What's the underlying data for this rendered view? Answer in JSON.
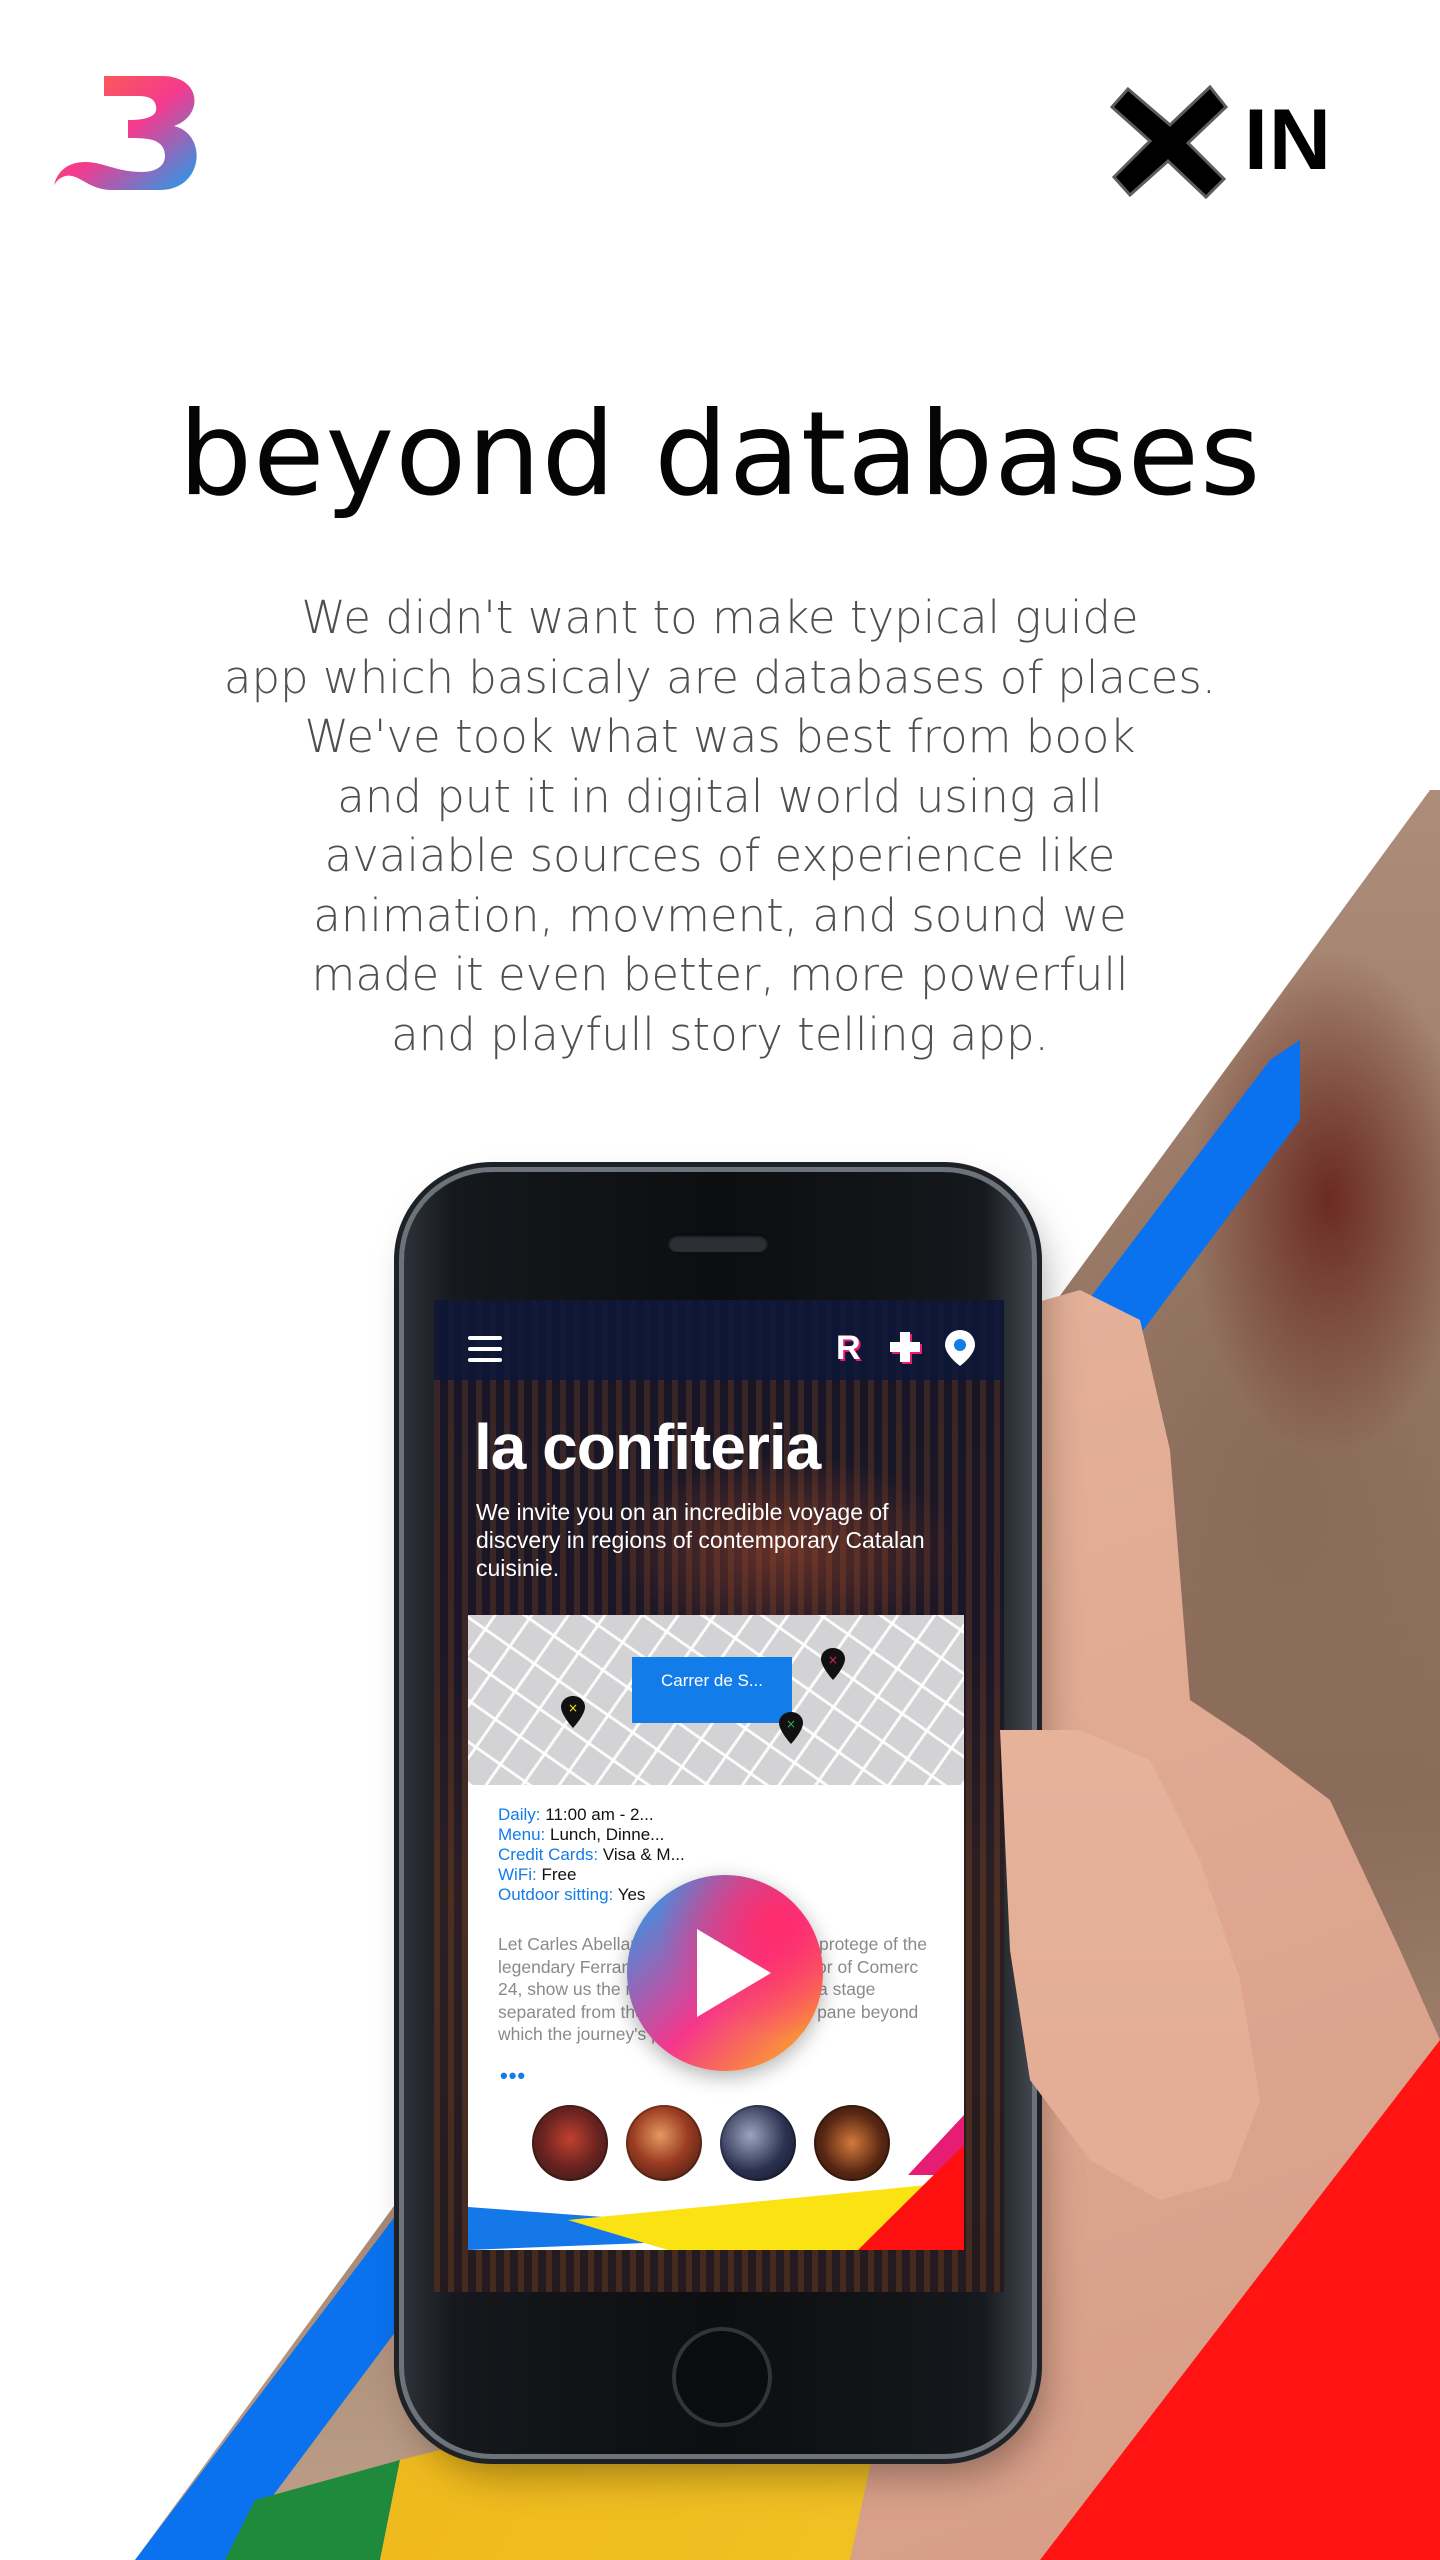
{
  "header": {
    "brand_logo": "b-wave-logo",
    "partner_logo_text": "IN",
    "partner_logo_icon": "x-mark-icon"
  },
  "hero": {
    "headline": "beyond databases",
    "description": "We didn't want to make typical guide\napp which basicaly are databases of places.\nWe've took what was best from book\nand put it in digital world using all\navaiable sources of experience like\nanimation, movment, and sound we\nmade it even better, more powerfull\nand playfull story telling app."
  },
  "app": {
    "toolbar": {
      "menu_icon": "hamburger-menu-icon",
      "r_label": "R",
      "icons": [
        "r-badge-icon",
        "plus-icon",
        "location-pin-icon"
      ]
    },
    "venue": {
      "title": "la confiteria",
      "intro": "We invite you on an incredible voyage of discvery in regions of contemporary Catalan cuisinie."
    },
    "map": {
      "street_label": "Carrer de S..."
    },
    "details": [
      {
        "key": "Daily:",
        "value": "11:00 am - 2..."
      },
      {
        "key": "Menu:",
        "value": "Lunch, Dinne..."
      },
      {
        "key": "Credit Cards:",
        "value": "Visa & M..."
      },
      {
        "key": "WiFi:",
        "value": "Free"
      },
      {
        "key": "Outdoor sitting:",
        "value": "Yes"
      }
    ],
    "story": "Let Carles Abellan, its enfant-terrible and protege of the legendary Ferran Adria, as well as prorietor of Comerc 24, show us the ropes. His kitchen is like a stage separated from the audience witha  glass pane beyond which the journey's protagonists...",
    "more": "•••",
    "play_icon": "play-icon"
  },
  "colors": {
    "accent_blue": "#127ce8",
    "red": "#ff1313",
    "yellow": "#f7c418",
    "magenta": "#e71d73"
  }
}
